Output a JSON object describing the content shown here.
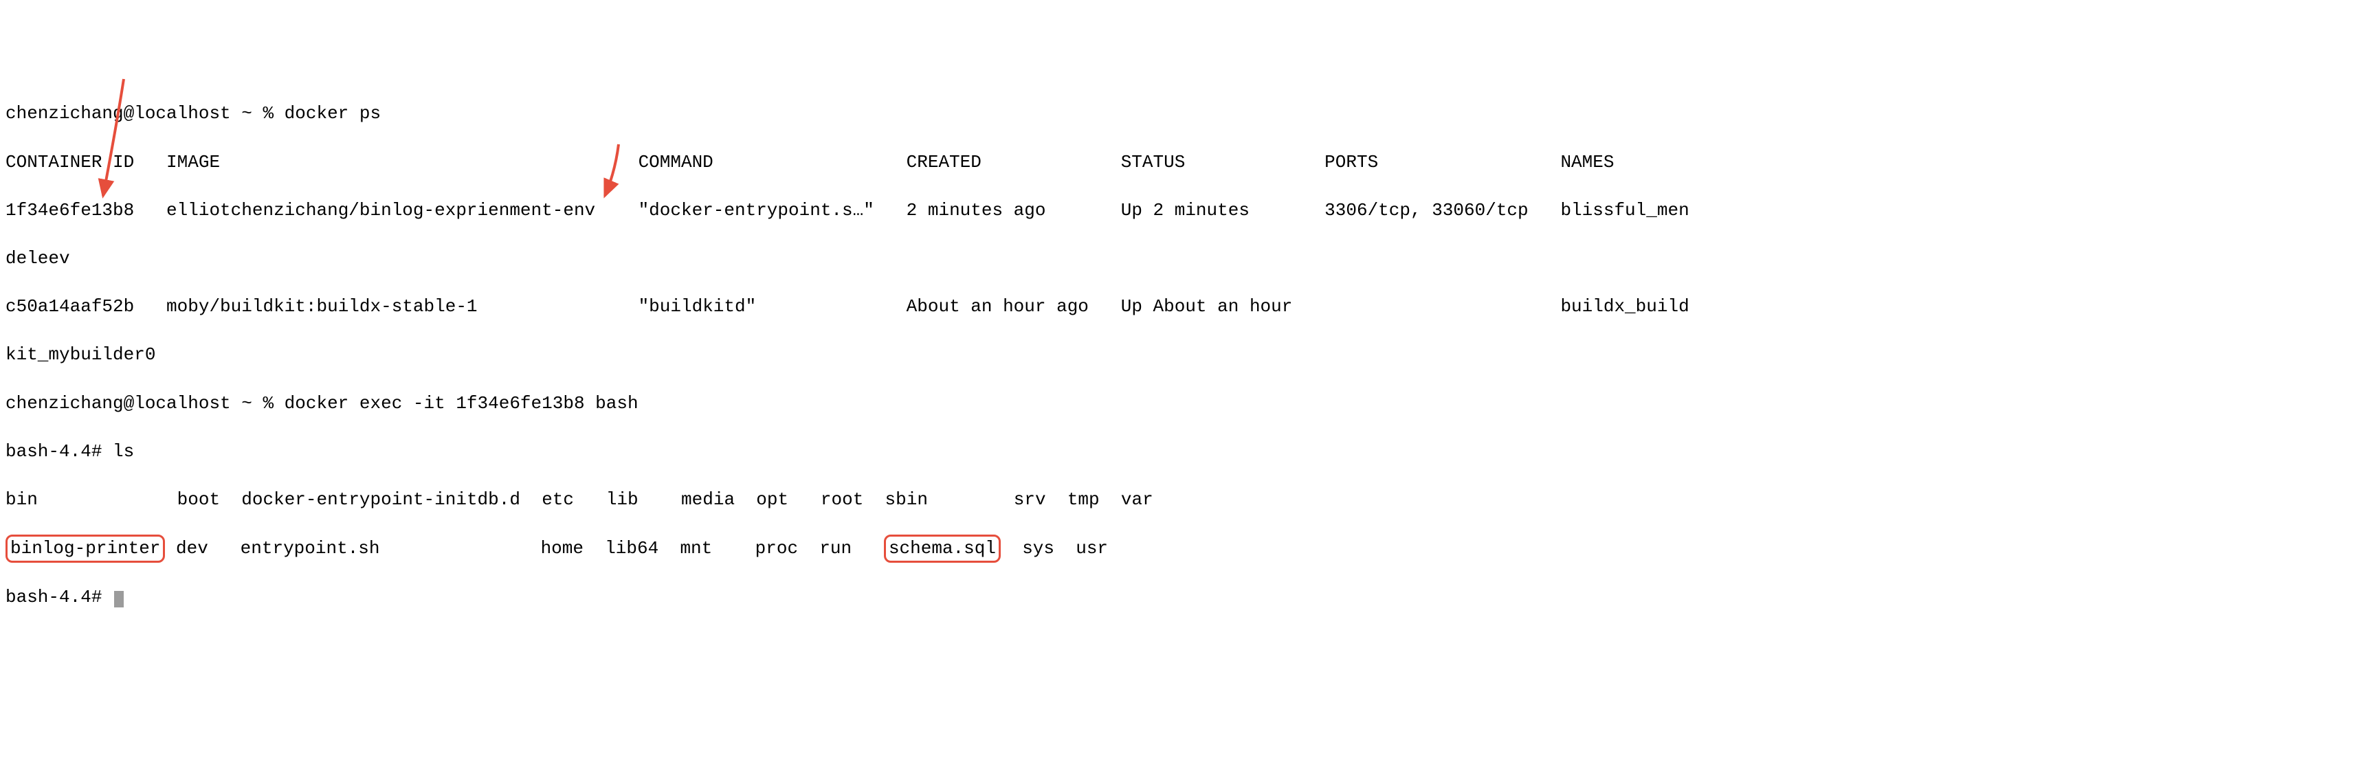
{
  "prompt1": "chenzichang@localhost ~ % ",
  "cmd1": "docker ps",
  "headers": {
    "container_id": "CONTAINER ID",
    "image": "IMAGE",
    "command": "COMMAND",
    "created": "CREATED",
    "status": "STATUS",
    "ports": "PORTS",
    "names": "NAMES"
  },
  "rows": [
    {
      "id": "1f34e6fe13b8",
      "image": "elliotchenzichang/binlog-exprienment-env",
      "command": "\"docker-entrypoint.s…\"",
      "created": "2 minutes ago",
      "status": "Up 2 minutes",
      "ports": "3306/tcp, 33060/tcp",
      "names_pt1": "blissful_men",
      "names_pt2": "deleev"
    },
    {
      "id": "c50a14aaf52b",
      "image": "moby/buildkit:buildx-stable-1",
      "command": "\"buildkitd\"",
      "created": "About an hour ago",
      "status": "Up About an hour",
      "ports": "",
      "names_pt1": "buildx_build",
      "names_pt2": "kit_mybuilder0"
    }
  ],
  "prompt2": "chenzichang@localhost ~ % ",
  "cmd2": "docker exec -it 1f34e6fe13b8 bash",
  "bash_prompt": "bash-4.4# ",
  "cmd3": "ls",
  "ls_row1": {
    "c0": "bin",
    "c1": "boot",
    "c2": "docker-entrypoint-initdb.d",
    "c3": "etc",
    "c4": "lib",
    "c5": "media",
    "c6": "opt",
    "c7": "root",
    "c8": "sbin",
    "c9": "srv",
    "c10": "tmp",
    "c11": "var"
  },
  "ls_row2": {
    "c0": "binlog-printer",
    "c1": "dev",
    "c2": "entrypoint.sh",
    "c3": "home",
    "c4": "lib64",
    "c5": "mnt",
    "c6": "proc",
    "c7": "run",
    "c8": "schema.sql",
    "c9": "sys",
    "c10": "usr"
  },
  "annotations": {
    "arrow_color": "#e64e3c"
  }
}
